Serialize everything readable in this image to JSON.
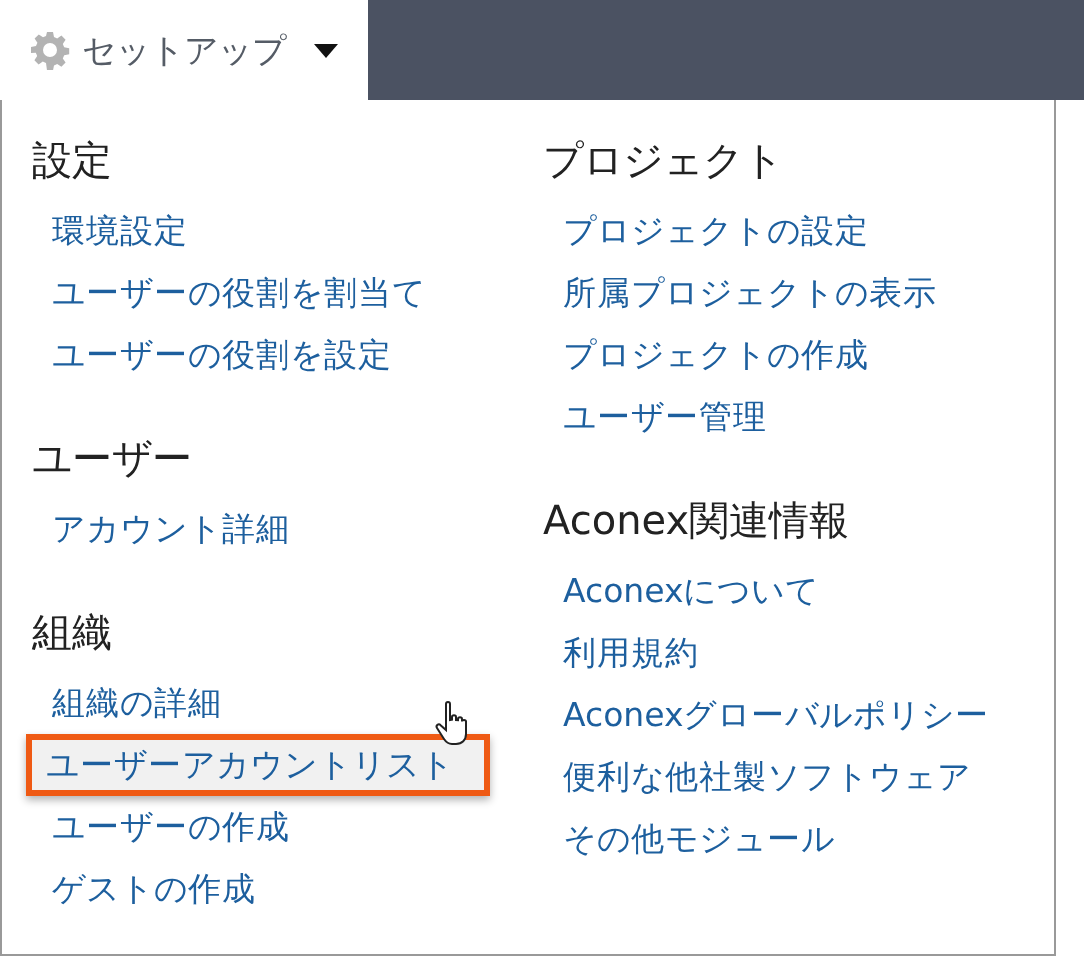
{
  "menu_button": {
    "label": "セットアップ"
  },
  "columns": [
    {
      "sections": [
        {
          "heading": "設定",
          "items": [
            {
              "label": "環境設定",
              "highlighted": false
            },
            {
              "label": "ユーザーの役割を割当て",
              "highlighted": false
            },
            {
              "label": "ユーザーの役割を設定",
              "highlighted": false
            }
          ]
        },
        {
          "heading": "ユーザー",
          "items": [
            {
              "label": "アカウント詳細",
              "highlighted": false
            }
          ]
        },
        {
          "heading": "組織",
          "items": [
            {
              "label": "組織の詳細",
              "highlighted": false
            },
            {
              "label": "ユーザーアカウントリスト",
              "highlighted": true
            },
            {
              "label": "ユーザーの作成",
              "highlighted": false
            },
            {
              "label": "ゲストの作成",
              "highlighted": false
            }
          ]
        }
      ]
    },
    {
      "sections": [
        {
          "heading": "プロジェクト",
          "items": [
            {
              "label": "プロジェクトの設定",
              "highlighted": false
            },
            {
              "label": "所属プロジェクトの表示",
              "highlighted": false
            },
            {
              "label": "プロジェクトの作成",
              "highlighted": false
            },
            {
              "label": "ユーザー管理",
              "highlighted": false
            }
          ]
        },
        {
          "heading": "Aconex関連情報",
          "items": [
            {
              "label": "Aconexについて",
              "highlighted": false
            },
            {
              "label": "利用規約",
              "highlighted": false
            },
            {
              "label": "Aconexグローバルポリシー",
              "highlighted": false
            },
            {
              "label": "便利な他社製ソフトウェア",
              "highlighted": false
            },
            {
              "label": "その他モジュール",
              "highlighted": false
            }
          ]
        }
      ]
    }
  ]
}
